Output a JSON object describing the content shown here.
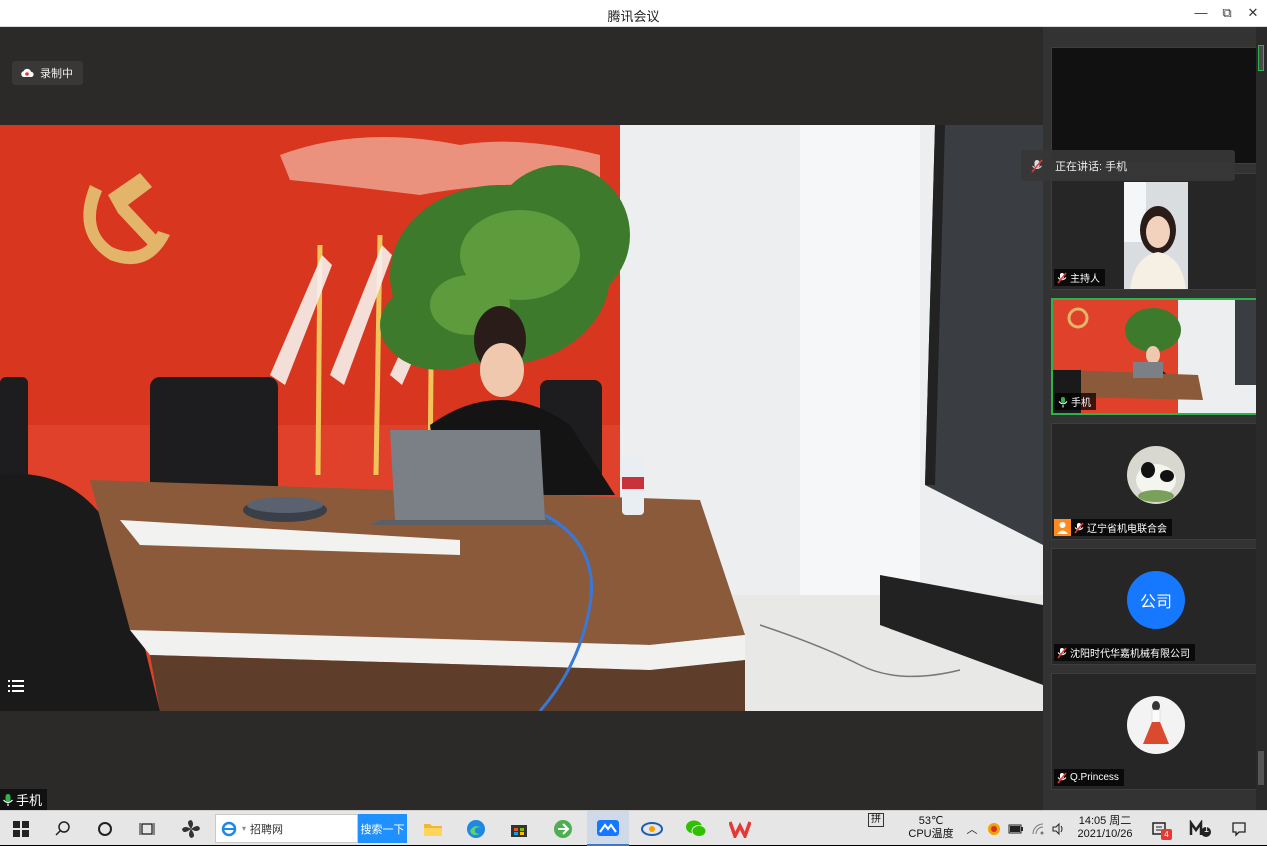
{
  "app": {
    "title": "腾讯会议"
  },
  "window_controls": {
    "minimize": "—",
    "restore": "⧉",
    "close": "✕"
  },
  "recording": {
    "label": "录制中"
  },
  "speaking_toast": {
    "label": "正在讲话: 手机"
  },
  "self_view": {
    "label": "手机"
  },
  "participants": [
    {
      "name": "",
      "type": "video-off"
    },
    {
      "name": "主持人",
      "type": "video"
    },
    {
      "name": "手机",
      "type": "video",
      "active": true
    },
    {
      "name": "辽宁省机电联合会",
      "type": "avatar-photo"
    },
    {
      "name": "沈阳时代华嘉机械有限公司",
      "type": "avatar-text",
      "avatar_text": "公司"
    },
    {
      "name": "Q.Princess",
      "type": "avatar-photo"
    }
  ],
  "taskbar": {
    "search_text": "招聘网",
    "search_button": "搜索一下",
    "ime": "拼",
    "temperature": "53℃",
    "temperature_label": "CPU温度",
    "time": "14:05 周二",
    "date": "2021/10/26",
    "notification_count": "4",
    "app_badge": "1"
  },
  "colors": {
    "accent_green": "#2fb24c",
    "avatar_blue": "#1677ff",
    "taskbar": "#e6e6e6"
  }
}
